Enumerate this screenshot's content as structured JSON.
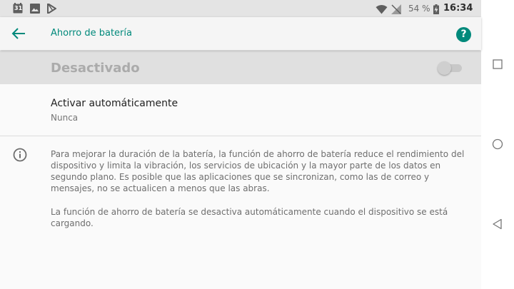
{
  "status_bar": {
    "calendar_day": "31",
    "battery_percent": "54 %",
    "time": "16:34",
    "icons": [
      "calendar-icon",
      "image-icon",
      "play-store-icon",
      "wifi-icon",
      "no-signal-icon",
      "battery-charging-icon"
    ]
  },
  "app_bar": {
    "title": "Ahorro de batería",
    "help_label": "?",
    "accent_color": "#00897b"
  },
  "master_switch": {
    "label": "Desactivado",
    "enabled": false
  },
  "auto_setting": {
    "title": "Activar automáticamente",
    "value": "Nunca"
  },
  "info": {
    "paragraph1": "Para mejorar la duración de la batería, la función de ahorro de batería reduce el rendimiento del dispositivo y limita la vibración, los servicios de ubicación y la mayor parte de los datos en segundo plano. Es posible que las aplicaciones que se sincronizan, como las de correo y mensajes, no se actualicen a menos que las abras.",
    "paragraph2": "La función de ahorro de batería se desactiva automáticamente cuando el dispositivo se está cargando."
  },
  "nav_bar": {
    "buttons": [
      "recents-square-icon",
      "home-circle-icon",
      "back-triangle-icon"
    ]
  }
}
